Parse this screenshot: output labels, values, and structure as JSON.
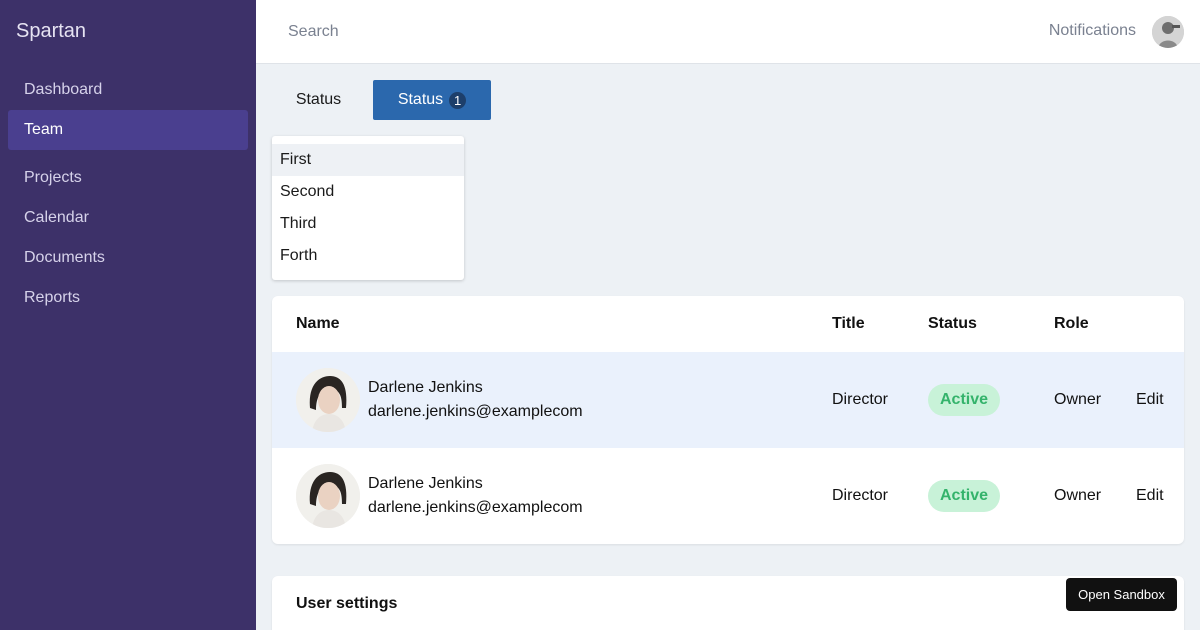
{
  "sidebar": {
    "brand": "Spartan",
    "items": [
      {
        "label": "Dashboard"
      },
      {
        "label": "Team"
      },
      {
        "label": "Projects"
      },
      {
        "label": "Calendar"
      },
      {
        "label": "Documents"
      },
      {
        "label": "Reports"
      }
    ],
    "active_item": "Team"
  },
  "topbar": {
    "search_placeholder": "Search",
    "notifications_label": "Notifications"
  },
  "filters": {
    "tab_label": "Status",
    "button_label": "Status",
    "button_count": "1",
    "dropdown_options": [
      "First",
      "Second",
      "Third",
      "Forth"
    ],
    "highlighted_option": "First"
  },
  "table": {
    "headers": {
      "name": "Name",
      "title": "Title",
      "status": "Status",
      "role": "Role"
    },
    "rows": [
      {
        "name": "Darlene Jenkins",
        "email": "darlene.jenkins@examplecom",
        "title": "Director",
        "status": "Active",
        "role": "Owner",
        "action": "Edit"
      },
      {
        "name": "Darlene Jenkins",
        "email": "darlene.jenkins@examplecom",
        "title": "Director",
        "status": "Active",
        "role": "Owner",
        "action": "Edit"
      }
    ]
  },
  "settings": {
    "title": "User settings"
  },
  "sandbox": {
    "label": "Open Sandbox"
  },
  "colors": {
    "sidebar_bg": "#3d3169",
    "sidebar_active": "#4a3f8f",
    "primary_button": "#2b68ad",
    "row_highlight": "#eaf1fc",
    "badge_bg": "#c8f2d8",
    "badge_text": "#34b36b",
    "page_bg": "#edf1f5"
  }
}
